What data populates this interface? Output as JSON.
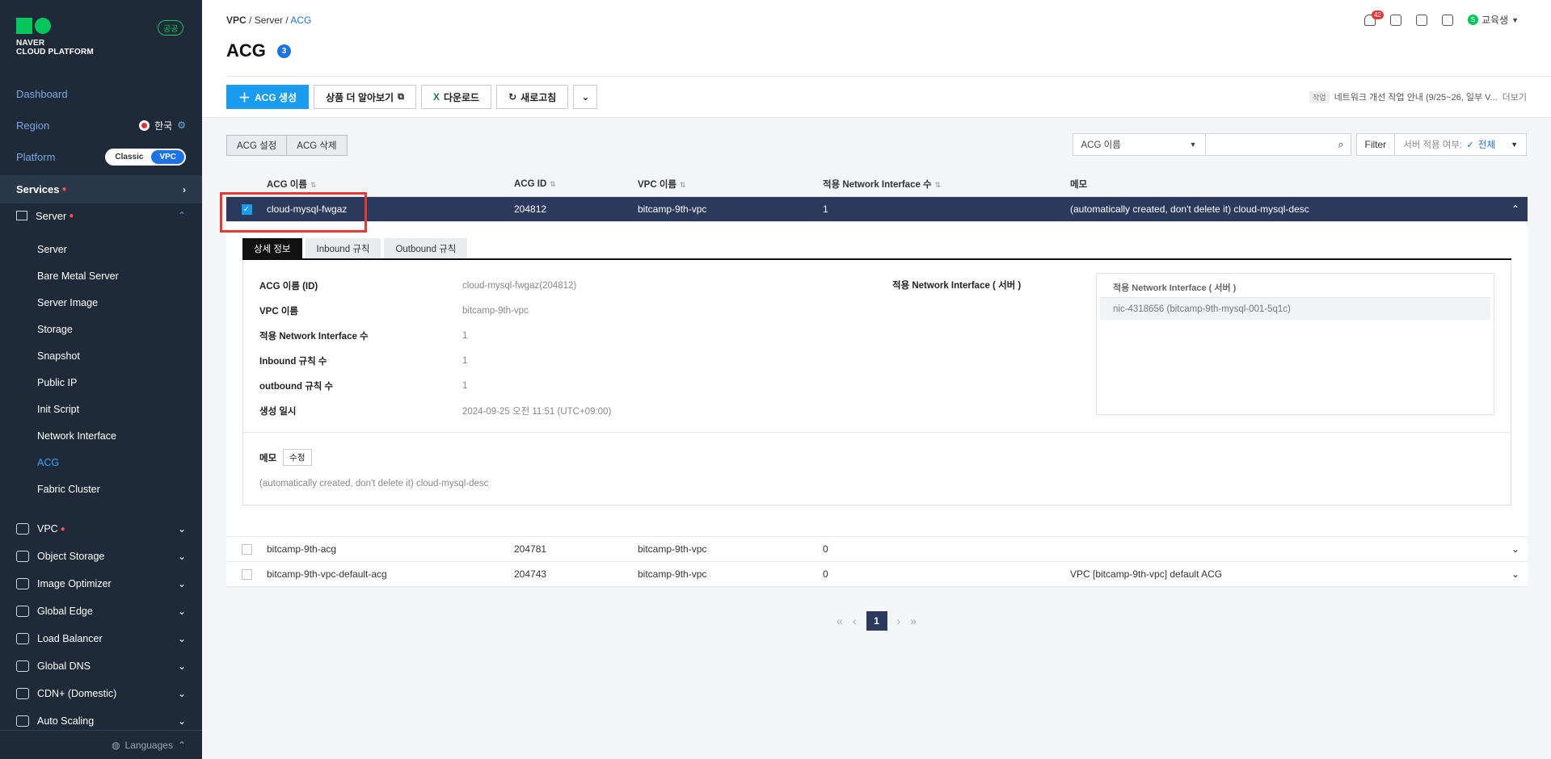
{
  "brand": {
    "line1": "NAVER",
    "line2": "CLOUD PLATFORM",
    "badge": "공공"
  },
  "sidebar": {
    "dashboard": "Dashboard",
    "region_label": "Region",
    "region_value": "한국",
    "platform_label": "Platform",
    "platform_options": [
      "Classic",
      "VPC"
    ],
    "services": "Services",
    "server_group": "Server",
    "server_items": [
      "Server",
      "Bare Metal Server",
      "Server Image",
      "Storage",
      "Snapshot",
      "Public IP",
      "Init Script",
      "Network Interface",
      "ACG",
      "Fabric Cluster"
    ],
    "active_item": "ACG",
    "categories": [
      "VPC",
      "Object Storage",
      "Image Optimizer",
      "Global Edge",
      "Load Balancer",
      "Global DNS",
      "CDN+ (Domestic)",
      "Auto Scaling"
    ],
    "languages": "Languages"
  },
  "header": {
    "breadcrumb": [
      "VPC",
      "Server",
      "ACG"
    ],
    "title": "ACG",
    "title_count": "3",
    "notif_count": "42",
    "user_initial": "S",
    "user_name": "교육생"
  },
  "toolbar": {
    "create": "ACG 생성",
    "learn_more": "상품 더 알아보기",
    "download": "다운로드",
    "refresh": "새로고침"
  },
  "notice": {
    "tag": "작업",
    "text": "네트워크 개선 작업 안내 (9/25~26, 일부 V...",
    "more": "더보기"
  },
  "actions": {
    "settings": "ACG 설정",
    "delete": "ACG 삭제"
  },
  "filter": {
    "select": "ACG 이름",
    "filter_btn": "Filter",
    "server_label": "서버 적용 여부:",
    "server_value": "전체"
  },
  "table": {
    "headers": [
      "ACG 이름",
      "ACG ID",
      "VPC 이름",
      "적용 Network Interface 수",
      "메모"
    ],
    "rows": [
      {
        "name": "cloud-mysql-fwgaz",
        "id": "204812",
        "vpc": "bitcamp-9th-vpc",
        "nic": "1",
        "memo": "(automatically created, don't delete it) cloud-mysql-desc"
      },
      {
        "name": "bitcamp-9th-acg",
        "id": "204781",
        "vpc": "bitcamp-9th-vpc",
        "nic": "0",
        "memo": ""
      },
      {
        "name": "bitcamp-9th-vpc-default-acg",
        "id": "204743",
        "vpc": "bitcamp-9th-vpc",
        "nic": "0",
        "memo": "VPC [bitcamp-9th-vpc] default ACG"
      }
    ]
  },
  "detail": {
    "tabs": [
      "상세 정보",
      "Inbound 규칙",
      "Outbound 규칙"
    ],
    "fields": [
      {
        "k": "ACG 이름 (ID)",
        "v": "cloud-mysql-fwgaz(204812)"
      },
      {
        "k": "VPC 이름",
        "v": "bitcamp-9th-vpc"
      },
      {
        "k": "적용 Network Interface 수",
        "v": "1"
      },
      {
        "k": "Inbound 규칙 수",
        "v": "1"
      },
      {
        "k": "outbound 규칙 수",
        "v": "1"
      },
      {
        "k": "생성 일시",
        "v": "2024-09-25 오전 11:51 (UTC+09:00)"
      }
    ],
    "nic_label": "적용 Network Interface ( 서버 )",
    "nic_head": "적용 Network Interface ( 서버 )",
    "nic_item": "nic-4318656 (bitcamp-9th-mysql-001-5q1c)",
    "memo_label": "메모",
    "memo_edit": "수정",
    "memo_text": "(automatically created, don't delete it) cloud-mysql-desc"
  },
  "pagination": {
    "current": "1"
  },
  "colors": {
    "sidebar": "#1e2a38",
    "accent": "#1a9cf0",
    "selected_row": "#2b3a5c",
    "highlight": "#e53935"
  }
}
